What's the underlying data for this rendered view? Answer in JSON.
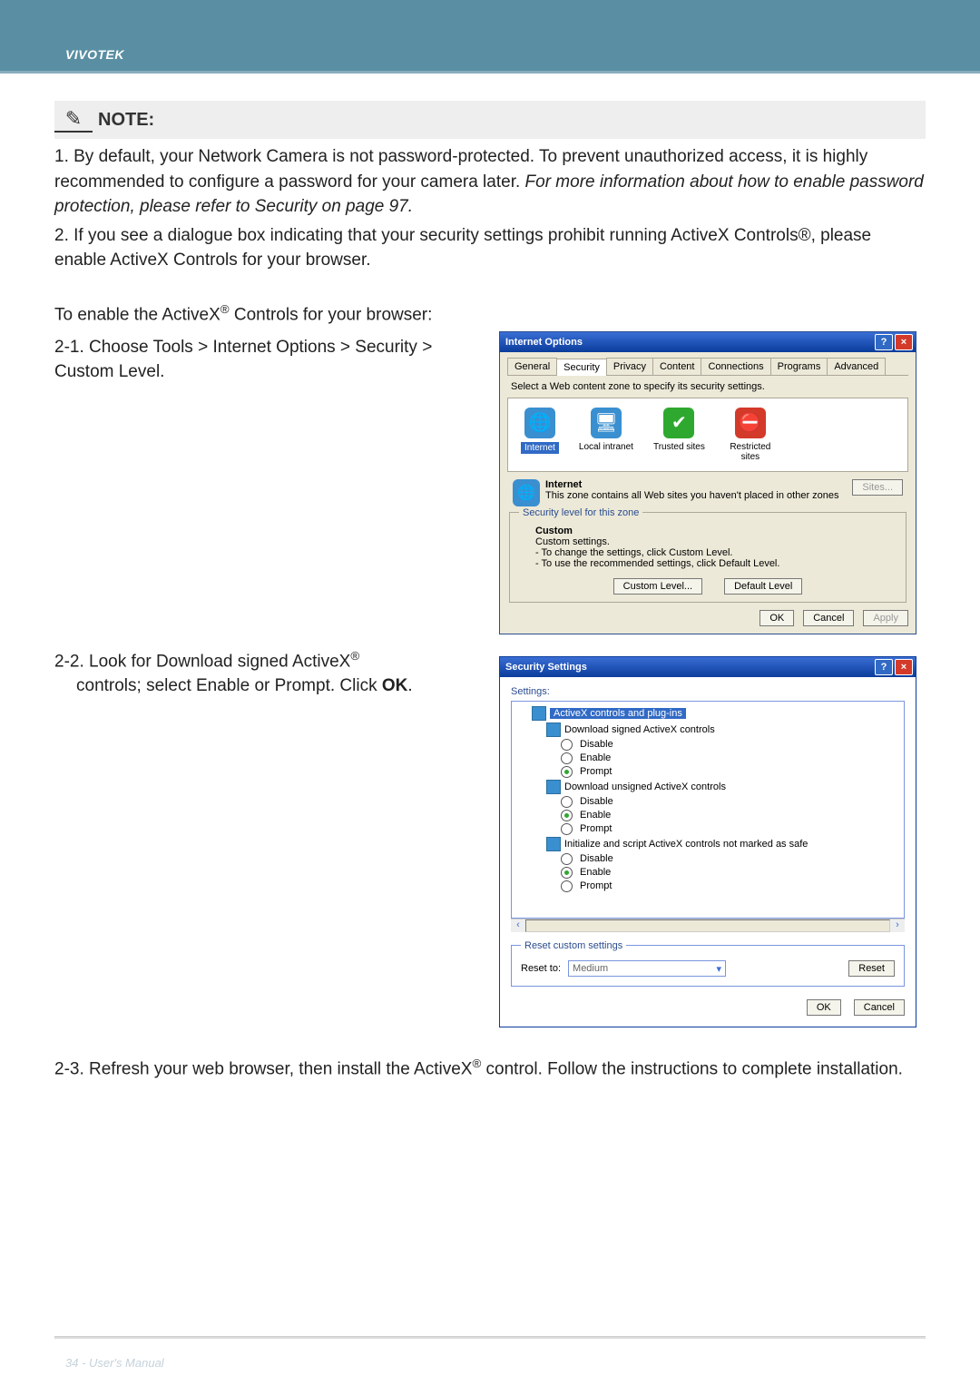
{
  "brand": "VIVOTEK",
  "note": {
    "heading": "NOTE:",
    "pencil": "✎"
  },
  "body": {
    "n1_pre": "1. By default, your Network Camera is not password-protected. To prevent unauthorized access, it is highly recommended to configure a password for your camera later. ",
    "n1_em": "For more information about how to enable password protection, please refer to Security on page 97.",
    "n2": "2. If you see a dialogue box indicating that your security settings prohibit running ActiveX Controls®, please enable ActiveX Controls for your browser.",
    "enable_pre": "To enable the ActiveX",
    "enable_post": " Controls for your browser:",
    "s21": "2-1. Choose Tools > Internet Options > Security > Custom Level.",
    "s22_pre": "2-2. Look for Download signed ActiveX",
    "s22_post": "controls; select Enable or Prompt. Click ",
    "ok": "OK",
    "period": ".",
    "s23_pre": "2-3. Refresh your web browser, then install the ActiveX",
    "s23_post": " control. Follow the instructions to complete installation.",
    "reg": "®"
  },
  "dlg1": {
    "title": "Internet Options",
    "tabs": [
      "General",
      "Security",
      "Privacy",
      "Content",
      "Connections",
      "Programs",
      "Advanced"
    ],
    "intro": "Select a Web content zone to specify its security settings.",
    "zones": {
      "internet": "Internet",
      "local": "Local intranet",
      "trusted": "Trusted sites",
      "restricted": "Restricted sites"
    },
    "zoneInfoTitle": "Internet",
    "zoneInfoText": "This zone contains all Web sites you haven't placed in other zones",
    "sitesBtn": "Sites...",
    "secLevelLegend": "Security level for this zone",
    "customTitle": "Custom",
    "customSub": "Custom settings.",
    "customLine1": "- To change the settings, click Custom Level.",
    "customLine2": "- To use the recommended settings, click Default Level.",
    "customLevelBtn": "Custom Level...",
    "defaultLevelBtn": "Default Level",
    "okBtn": "OK",
    "cancelBtn": "Cancel",
    "applyBtn": "Apply"
  },
  "dlg2": {
    "title": "Security Settings",
    "settingsLabel": "Settings:",
    "root": "ActiveX controls and plug-ins",
    "n1": "Download signed ActiveX controls",
    "n2": "Download unsigned ActiveX controls",
    "n3": "Initialize and script ActiveX controls not marked as safe",
    "opt": {
      "disable": "Disable",
      "enable": "Enable",
      "prompt": "Prompt"
    },
    "resetLegend": "Reset custom settings",
    "resetTo": "Reset to:",
    "medium": "Medium",
    "resetBtn": "Reset",
    "okBtn": "OK",
    "cancelBtn": "Cancel"
  },
  "footer": "34 - User's Manual"
}
